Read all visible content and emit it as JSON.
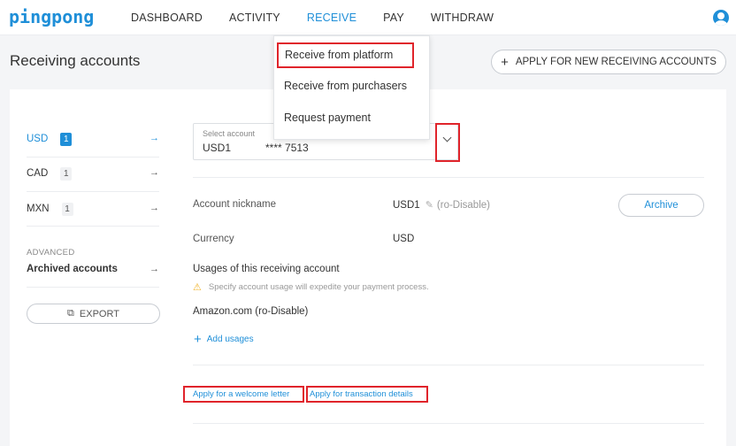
{
  "app": {
    "logo": "pingpong"
  },
  "nav": {
    "items": [
      {
        "label": "DASHBOARD"
      },
      {
        "label": "ACTIVITY"
      },
      {
        "label": "RECEIVE"
      },
      {
        "label": "PAY"
      },
      {
        "label": "WITHDRAW"
      }
    ],
    "active": "RECEIVE"
  },
  "dropdown": {
    "items": [
      {
        "label": "Receive from platform"
      },
      {
        "label": "Receive from purchasers"
      },
      {
        "label": "Request payment"
      }
    ]
  },
  "page": {
    "title": "Receiving accounts",
    "apply_button": "APPLY FOR NEW RECEIVING ACCOUNTS"
  },
  "sidebar": {
    "currencies": [
      {
        "code": "USD",
        "count": "1"
      },
      {
        "code": "CAD",
        "count": "1"
      },
      {
        "code": "MXN",
        "count": "1"
      }
    ],
    "advanced_label": "ADVANCED",
    "archived_label": "Archived accounts",
    "export_label": "EXPORT"
  },
  "account": {
    "select_label": "Select account",
    "select_value": "USD1",
    "select_mask": "**** 7513",
    "nickname_label": "Account nickname",
    "nickname_value": "USD1",
    "nickname_disabled": "(ro-Disable)",
    "archive_button": "Archive",
    "currency_label": "Currency",
    "currency_value": "USD",
    "usages_label": "Usages of this receiving account",
    "usages_warning": "Specify account usage will expedite your payment process.",
    "usage_item": "Amazon.com (ro-Disable)",
    "add_usages": "Add usages",
    "welcome_letter_link": "Apply for a welcome letter",
    "transaction_details_link": "Apply for transaction details"
  },
  "colors": {
    "accent": "#1f8fd8",
    "highlight": "#e0242b",
    "warning": "#f0b429"
  }
}
